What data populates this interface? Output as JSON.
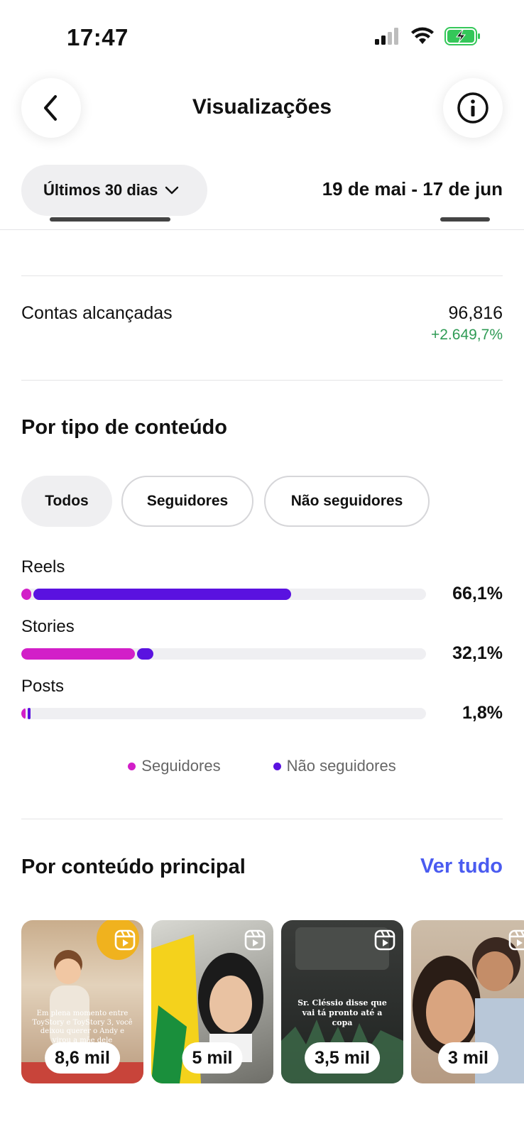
{
  "status": {
    "time": "17:47",
    "icons": [
      "cellular-signal-icon",
      "wifi-icon",
      "battery-charging-icon"
    ],
    "battery_color": "#34c759"
  },
  "header": {
    "title": "Visualizações",
    "back_icon": "chevron-left-icon",
    "info_icon": "info-icon"
  },
  "filter": {
    "range_label": "Últimos 30 dias",
    "range_icon": "chevron-down-icon",
    "date_range": "19 de mai - 17 de jun"
  },
  "metric": {
    "label": "Contas alcançadas",
    "value": "96,816",
    "change": "+2.649,7%",
    "change_color": "#2f9b55"
  },
  "content_type": {
    "title": "Por tipo de conteúdo",
    "chips": [
      "Todos",
      "Seguidores",
      "Não seguidores"
    ],
    "active_chip": "Todos",
    "rows": [
      {
        "label": "Reels",
        "percent": "66,1%",
        "followers_fraction": 0.025,
        "non_followers_fraction": 0.636
      },
      {
        "label": "Stories",
        "percent": "32,1%",
        "followers_fraction": 0.28,
        "non_followers_fraction": 0.041
      },
      {
        "label": "Posts",
        "percent": "1,8%",
        "followers_fraction": 0.011,
        "non_followers_fraction": 0.007
      }
    ],
    "legend": {
      "followers": "Seguidores",
      "non_followers": "Não seguidores",
      "followers_color": "#d21fc8",
      "non_followers_color": "#5a12e0"
    }
  },
  "top_content": {
    "title": "Por conteúdo principal",
    "see_all": "Ver tudo",
    "see_all_color": "#4a5bf0",
    "items": [
      {
        "views": "8,6 mil",
        "caption": "Em plena momento entre ToyStory e ToyStory 3, você deixou querer o Andy e virou a mãe dele"
      },
      {
        "views": "5 mil",
        "caption": ""
      },
      {
        "views": "3,5 mil",
        "caption": "Sr. Cléssio disse que vai tá pronto até a copa"
      },
      {
        "views": "3 mil",
        "caption": ""
      }
    ]
  }
}
